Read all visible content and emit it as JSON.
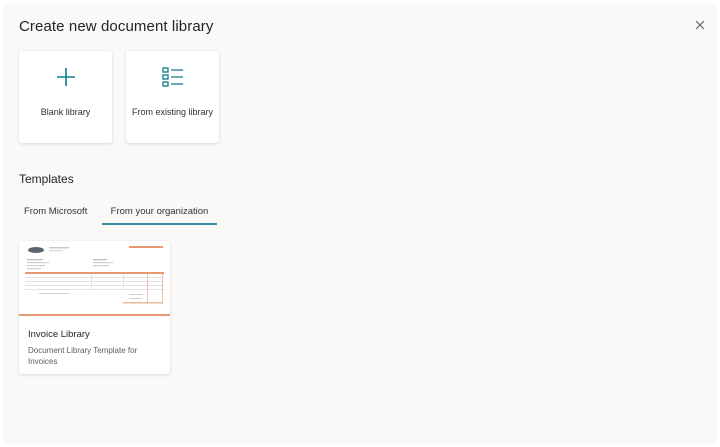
{
  "dialog": {
    "title": "Create new document library"
  },
  "create_options": [
    {
      "label": "Blank library",
      "icon": "plus-icon"
    },
    {
      "label": "From existing library",
      "icon": "list-icon"
    }
  ],
  "templates": {
    "heading": "Templates",
    "tabs": [
      {
        "label": "From Microsoft",
        "selected": false
      },
      {
        "label": "From your organization",
        "selected": true
      }
    ],
    "items": [
      {
        "name": "Invoice Library",
        "description": "Document Library Template for Invoices",
        "thumbnail": "invoice-thumbnail"
      }
    ]
  },
  "colors": {
    "accent": "#0f7b8a",
    "tab_underline": "#3a8fa0",
    "thumbnail_accent": "#e59a74",
    "panel_background": "#faf9f8"
  }
}
